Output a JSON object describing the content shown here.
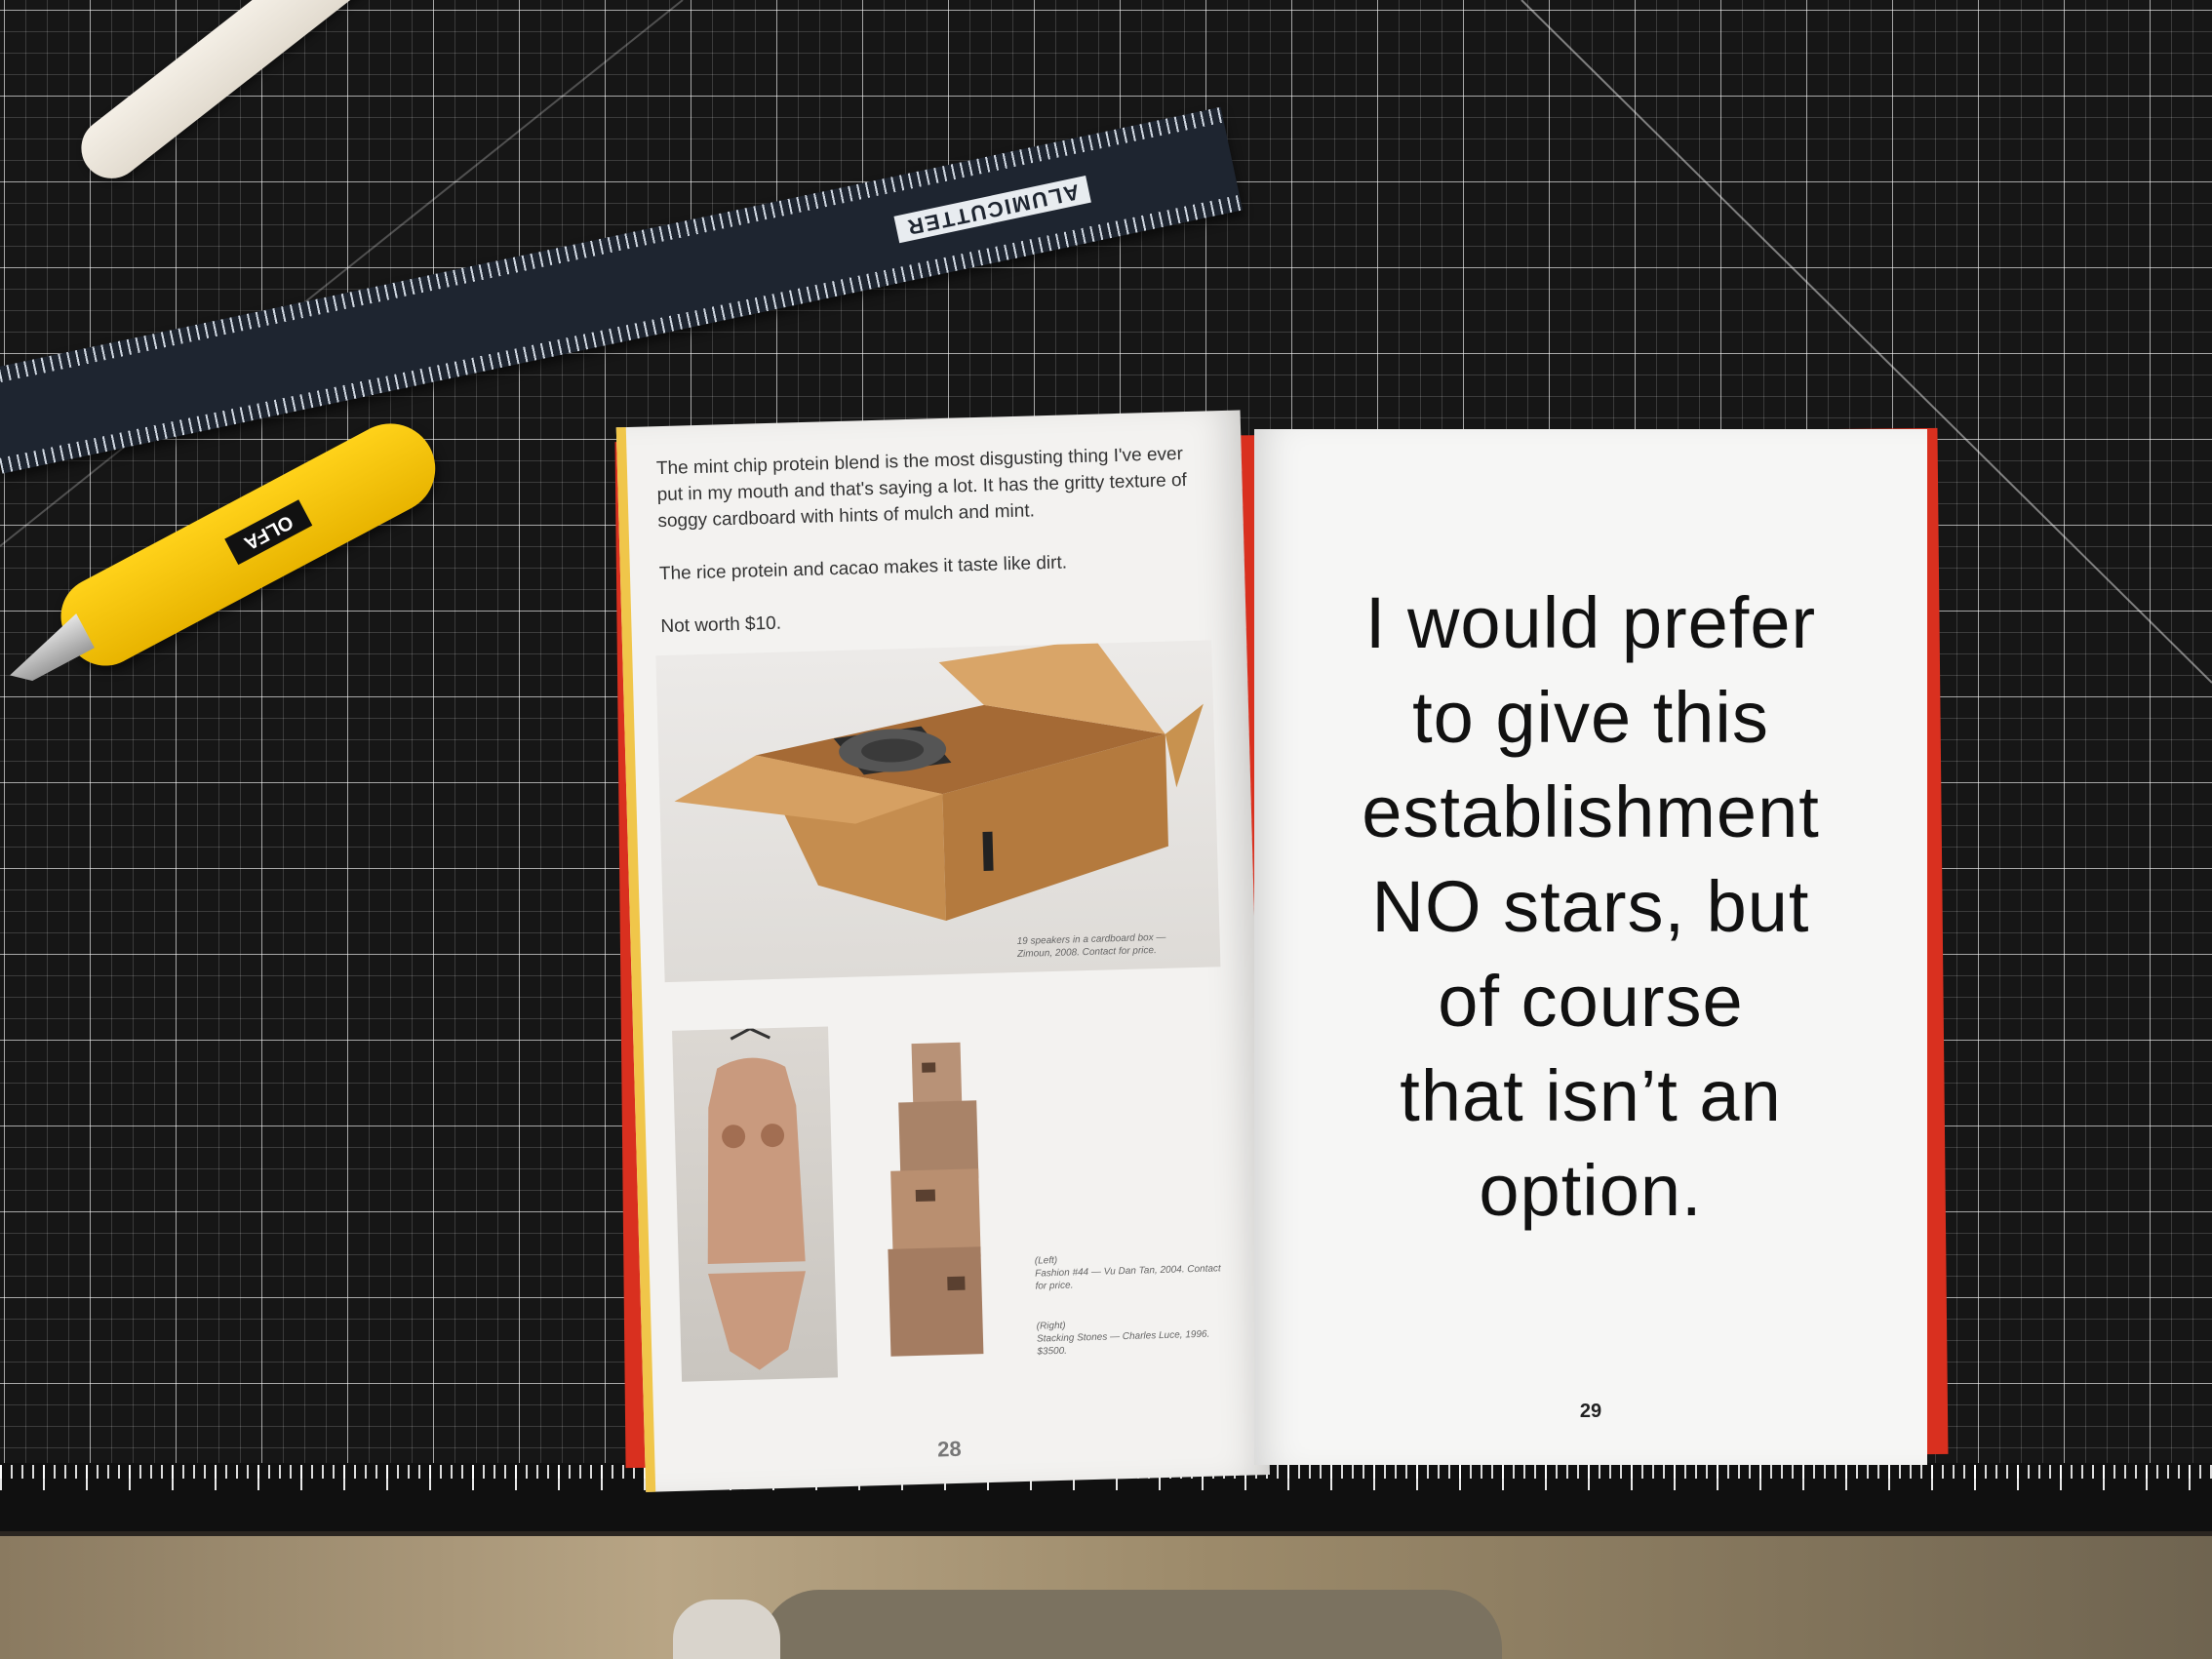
{
  "scene": {
    "mat_color": "#161616",
    "book_cover_color": "#d9301f",
    "cutter_color": "#ffd21a"
  },
  "tools": {
    "ruler_brand": "ALUMICUTTER",
    "cutter_brand": "OLFA"
  },
  "left_page": {
    "paragraphs": [
      "The mint chip protein blend is the most disgusting thing I've ever put in my mouth and that's saying a lot. It has the gritty texture of soggy cardboard with hints of mulch and mint.",
      "The rice protein and cacao makes it taste like dirt.",
      "Not worth $10."
    ],
    "box_caption_line1": "19 speakers in a cardboard box —",
    "box_caption_line2": "Zimoun, 2008. Contact for price.",
    "left_caption_tag": "(Left)",
    "left_caption_text": "Fashion #44 — Vu Dan Tan, 2004. Contact for price.",
    "right_caption_tag": "(Right)",
    "right_caption_text": "Stacking Stones — Charles Luce, 1996. $3500.",
    "page_number": "28"
  },
  "right_page": {
    "quote_lines": [
      "I would prefer",
      "to give this",
      "establishment",
      "NO stars, but",
      "of course",
      "that isn’t an",
      "option."
    ],
    "page_number": "29"
  }
}
